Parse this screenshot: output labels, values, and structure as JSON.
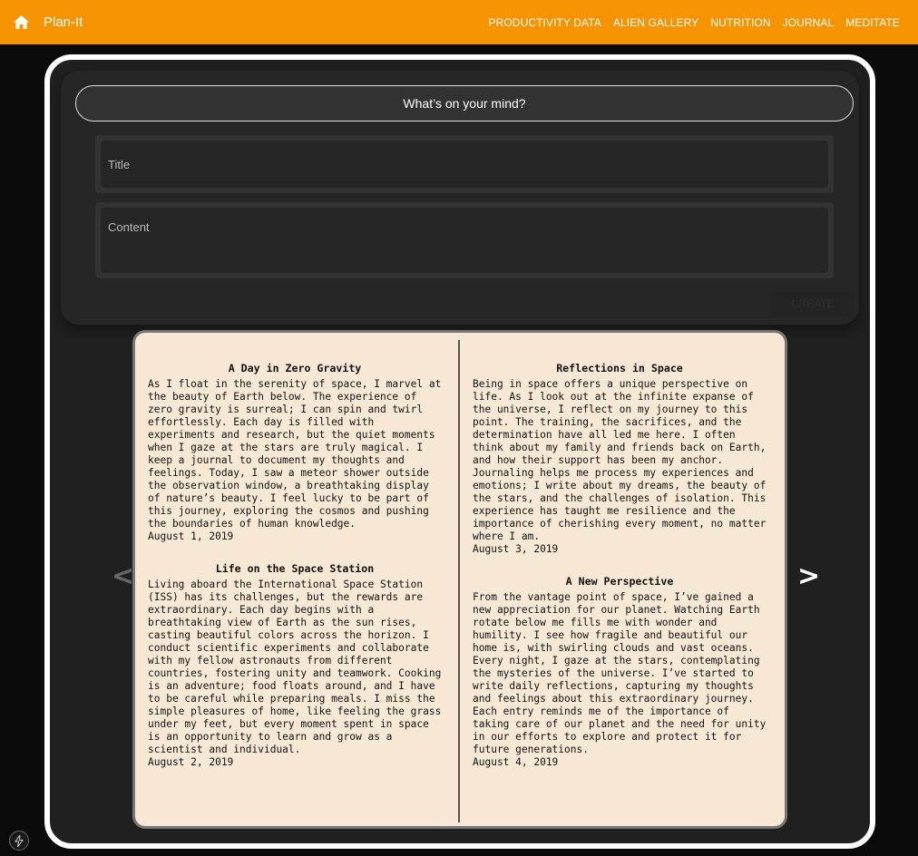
{
  "navbar": {
    "brand": "Plan-It",
    "links": [
      "PRODUCTIVITY DATA",
      "ALIEN GALLERY",
      "NUTRITION",
      "JOURNAL",
      "MEDITATE"
    ]
  },
  "composer": {
    "prompt": "What’s on your mind?",
    "title_placeholder": "Title",
    "content_placeholder": "Content",
    "create_label": "CREATE"
  },
  "book": {
    "prev_arrow": "<",
    "next_arrow": ">",
    "left": [
      {
        "title": "A Day in Zero Gravity",
        "body": "As I float in the serenity of space, I marvel at the beauty of Earth below. The experience of zero gravity is surreal; I can spin and twirl effortlessly. Each day is filled with experiments and research, but the quiet moments when I gaze at the stars are truly magical. I keep a journal to document my thoughts and feelings. Today, I saw a meteor shower outside the observation window, a breathtaking display of nature’s beauty. I feel lucky to be part of this journey, exploring the cosmos and pushing the boundaries of human knowledge.",
        "date": "August 1, 2019"
      },
      {
        "title": "Life on the Space Station",
        "body": "Living aboard the International Space Station (ISS) has its challenges, but the rewards are extraordinary. Each day begins with a breathtaking view of Earth as the sun rises, casting beautiful colors across the horizon. I conduct scientific experiments and collaborate with my fellow astronauts from different countries, fostering unity and teamwork. Cooking is an adventure; food floats around, and I have to be careful while preparing meals. I miss the simple pleasures of home, like feeling the grass under my feet, but every moment spent in space is an opportunity to learn and grow as a scientist and individual.",
        "date": "August 2, 2019"
      }
    ],
    "right": [
      {
        "title": "Reflections in Space",
        "body": "Being in space offers a unique perspective on life. As I look out at the infinite expanse of the universe, I reflect on my journey to this point. The training, the sacrifices, and the determination have all led me here. I often think about my family and friends back on Earth, and how their support has been my anchor. Journaling helps me process my experiences and emotions; I write about my dreams, the beauty of the stars, and the challenges of isolation. This experience has taught me resilience and the importance of cherishing every moment, no matter where I am.",
        "date": "August 3, 2019"
      },
      {
        "title": "A New Perspective",
        "body": "From the vantage point of space, I’ve gained a new appreciation for our planet. Watching Earth rotate below me fills me with wonder and humility. I see how fragile and beautiful our home is, with swirling clouds and vast oceans. Every night, I gaze at the stars, contemplating the mysteries of the universe. I’ve started to write daily reflections, capturing my thoughts and feelings about this extraordinary journey. Each entry reminds me of the importance of taking care of our planet and the need for unity in our efforts to explore and protect it for future generations.",
        "date": "August 4, 2019"
      }
    ]
  },
  "colors": {
    "navbar": "#f59300",
    "panel": "#202020",
    "page": "#f7e8d5"
  },
  "icons": {
    "home": "home-icon",
    "bolt": "bolt-icon"
  }
}
